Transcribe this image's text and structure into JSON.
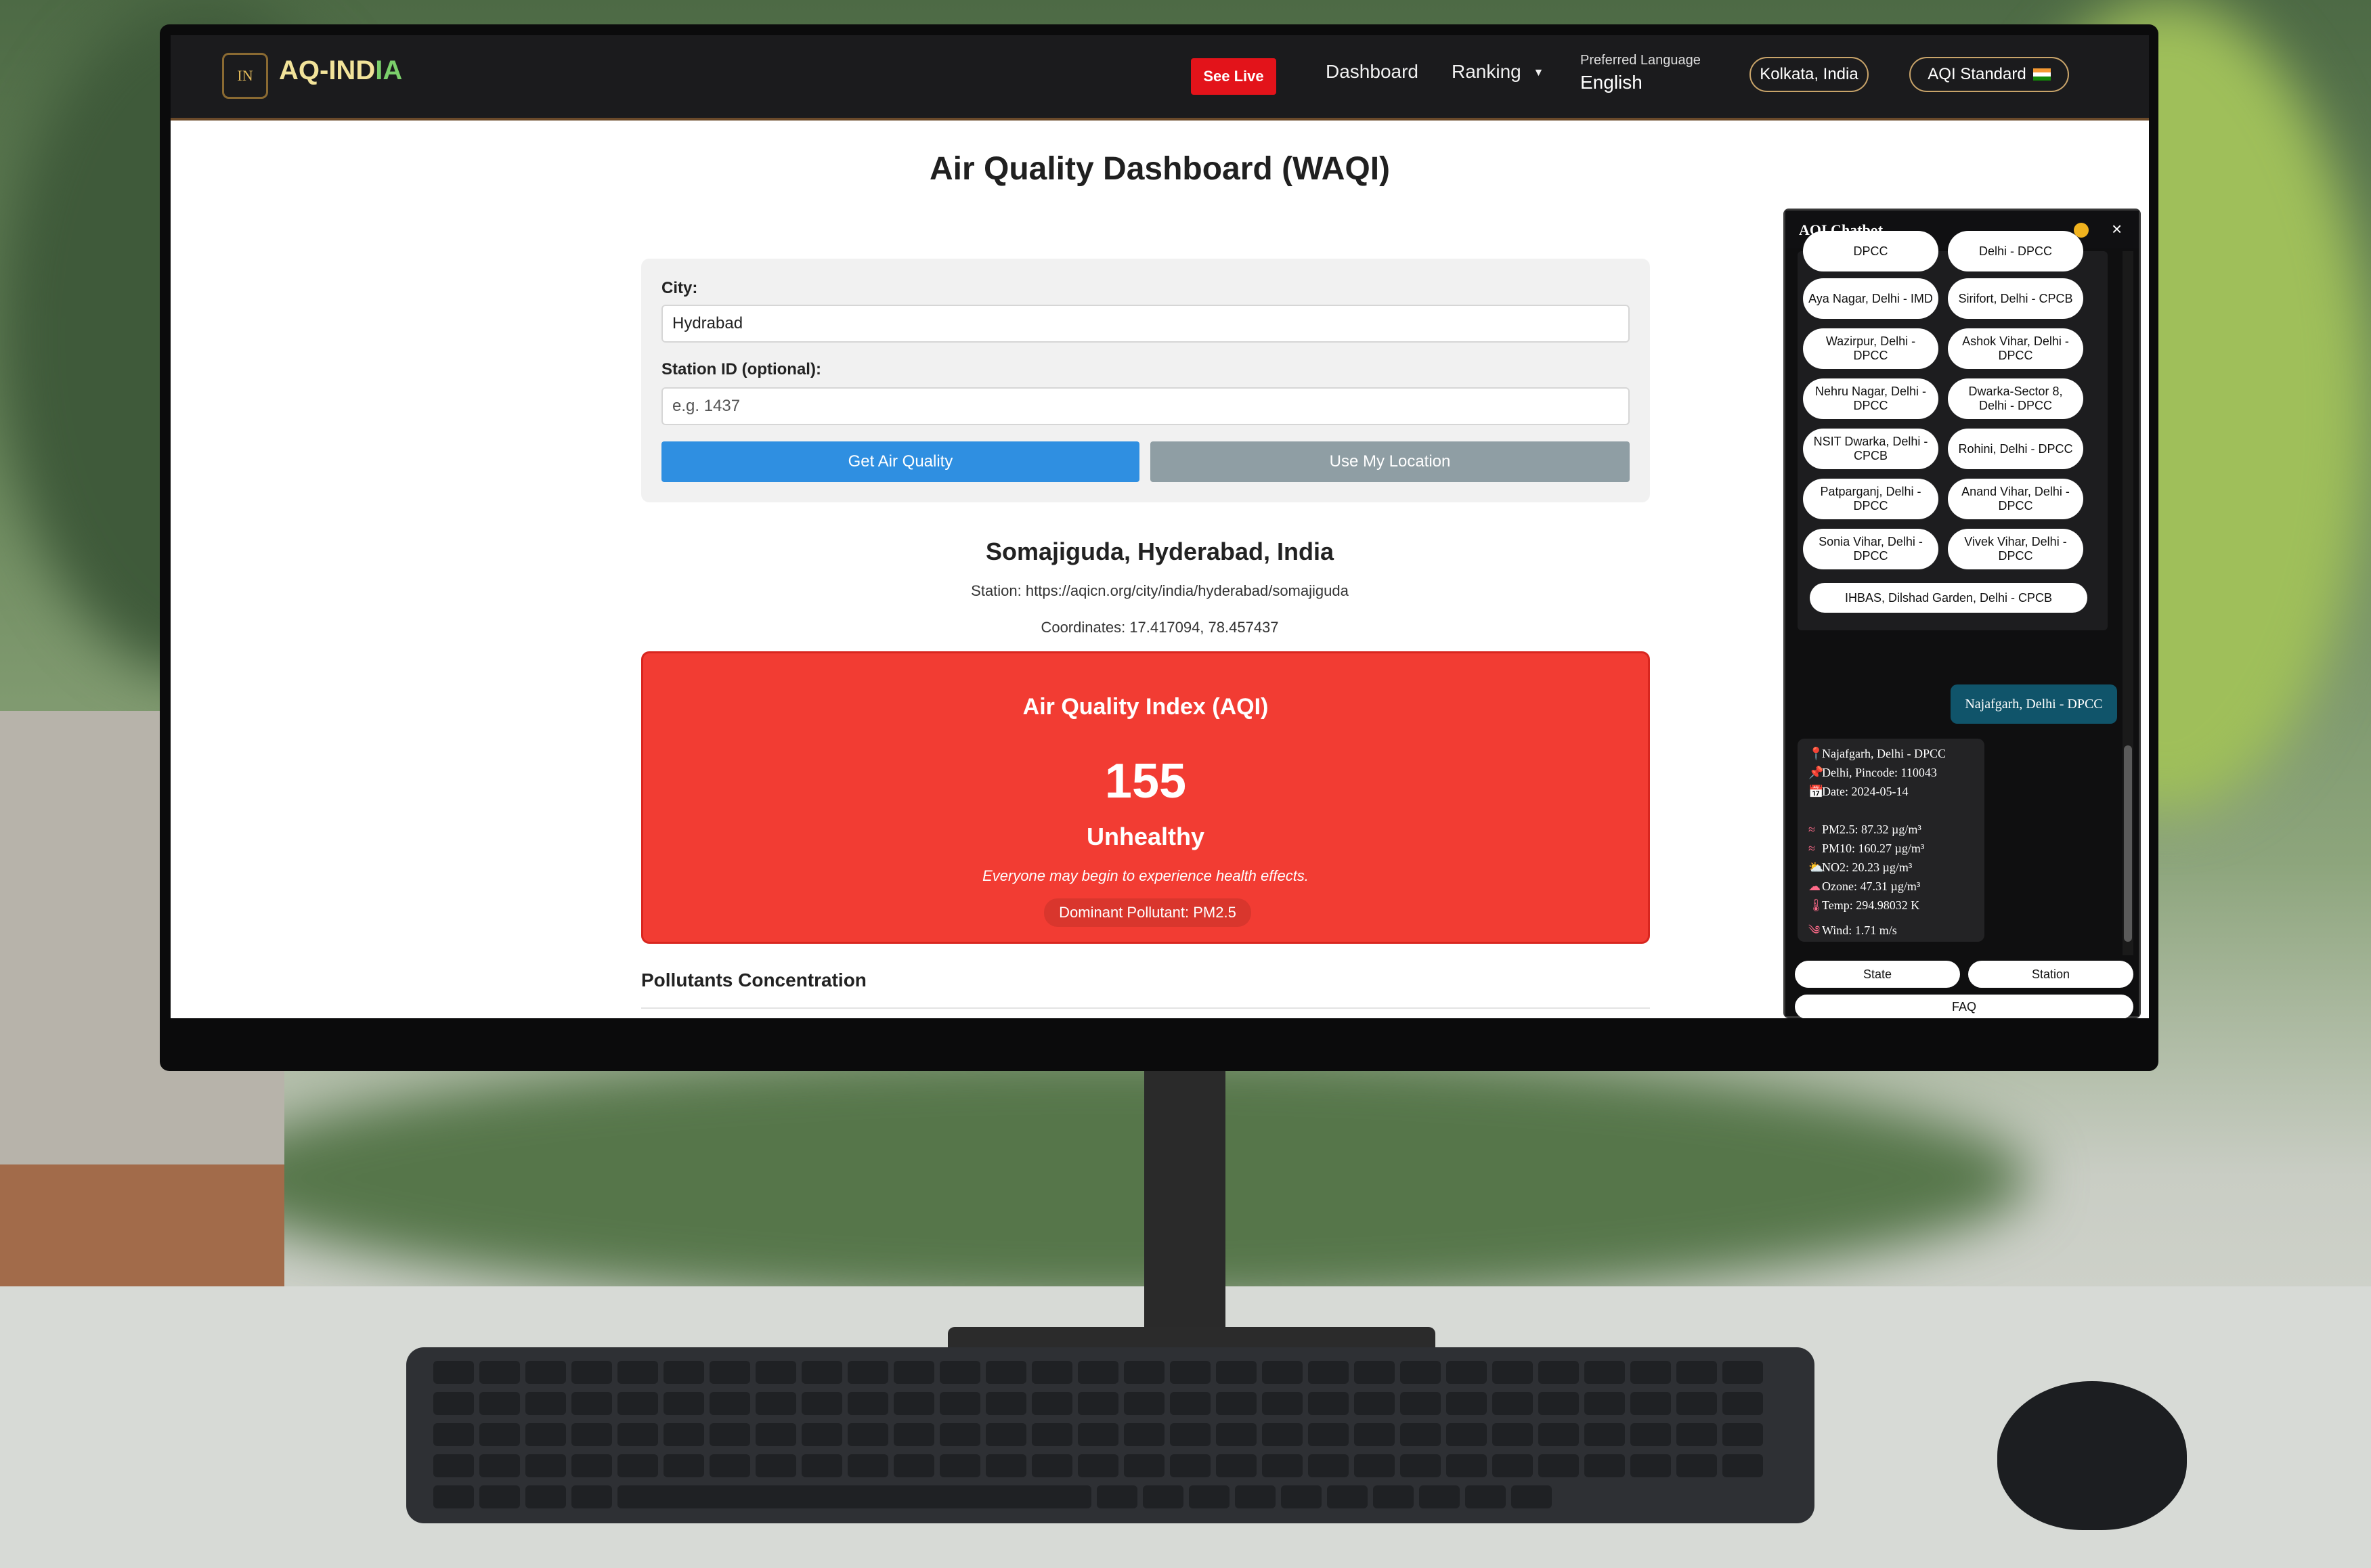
{
  "nav": {
    "logo_badge": "IN",
    "logo_text_main": "AQ-IND",
    "logo_text_hl": "IA",
    "see_live": "See Live",
    "dashboard": "Dashboard",
    "ranking": "Ranking",
    "ranking_caret": "▼",
    "lang_label": "Preferred Language",
    "lang_value": "English",
    "location": "Kolkata, India",
    "aqi_standard": "AQI Standard"
  },
  "page_title": "Air Quality Dashboard (WAQI)",
  "form": {
    "city_label": "City:",
    "city_value": "Hydrabad",
    "station_label": "Station ID (optional):",
    "station_placeholder": "e.g. 1437",
    "get_button": "Get Air Quality",
    "location_button": "Use My Location"
  },
  "station": {
    "name": "Somajiguda, Hyderabad, India",
    "url_line": "Station: https://aqicn.org/city/india/hyderabad/somajiguda",
    "coords_line": "Coordinates: 17.417094, 78.457437"
  },
  "aqi": {
    "heading": "Air Quality Index (AQI)",
    "value": "155",
    "category": "Unhealthy",
    "message": "Everyone may begin to experience health effects.",
    "dominant": "Dominant Pollutant: PM2.5",
    "color": "#f23c33"
  },
  "pollutants_heading": "Pollutants Concentration",
  "chatbot": {
    "title": "AQI Chatbot",
    "close": "×",
    "stations": [
      "DPCC",
      "Delhi - DPCC",
      "Aya Nagar, Delhi - IMD",
      "Sirifort, Delhi - CPCB",
      "Wazirpur, Delhi - DPCC",
      "Ashok Vihar, Delhi - DPCC",
      "Nehru Nagar, Delhi - DPCC",
      "Dwarka-Sector 8, Delhi - DPCC",
      "NSIT Dwarka, Delhi - CPCB",
      "Rohini, Delhi - DPCC",
      "Patparganj, Delhi - DPCC",
      "Anand Vihar, Delhi - DPCC",
      "Sonia Vihar, Delhi - DPCC",
      "Vivek Vihar, Delhi - DPCC",
      "IHBAS, Dilshad Garden, Delhi - CPCB"
    ],
    "user_message": "Najafgarh, Delhi - DPCC",
    "bot_lines": [
      {
        "icon": "📍",
        "text": "Najafgarh, Delhi - DPCC"
      },
      {
        "icon": "📌",
        "text": "Delhi, Pincode: 110043"
      },
      {
        "icon": "📅",
        "text": "Date: 2024-05-14"
      },
      {
        "icon": "≈",
        "text": "PM2.5: 87.32 µg/m³"
      },
      {
        "icon": "≈",
        "text": "PM10: 160.27 µg/m³"
      },
      {
        "icon": "⛅",
        "text": "NO2: 20.23 µg/m³"
      },
      {
        "icon": "☁",
        "text": "Ozone: 47.31 µg/m³"
      },
      {
        "icon": "🌡",
        "text": "Temp: 294.98032 K"
      },
      {
        "icon": "༄",
        "text": "Wind: 1.71 m/s"
      }
    ],
    "quick_state": "State",
    "quick_station": "Station",
    "quick_faq": "FAQ"
  }
}
